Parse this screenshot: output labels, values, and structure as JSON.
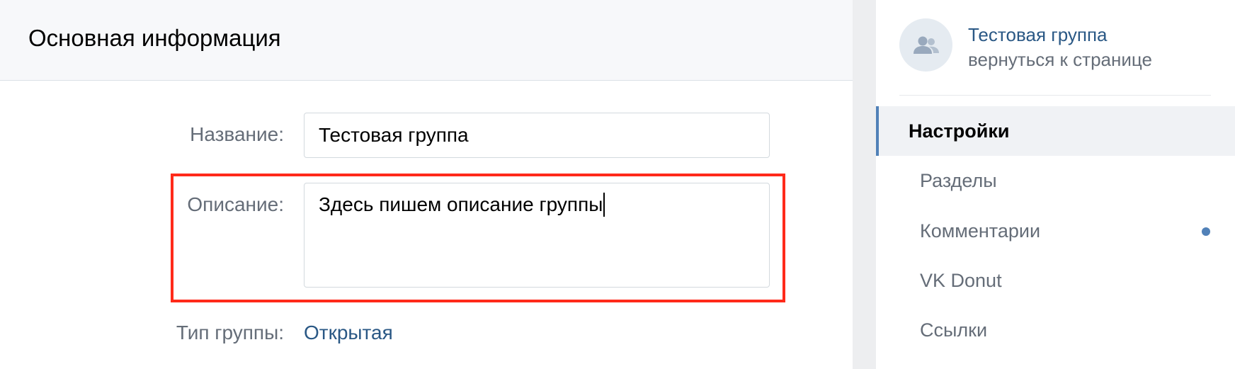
{
  "main": {
    "title": "Основная информация",
    "name_field": {
      "label": "Название:",
      "value": "Тестовая группа"
    },
    "description_field": {
      "label": "Описание:",
      "value": "Здесь пишем описание группы"
    },
    "group_type": {
      "label": "Тип группы:",
      "value": "Открытая"
    }
  },
  "sidebar": {
    "group_name": "Тестовая группа",
    "back_link": "вернуться к странице",
    "items": [
      {
        "label": "Настройки",
        "active": true
      },
      {
        "label": "Разделы"
      },
      {
        "label": "Комментарии",
        "has_dot": true
      },
      {
        "label": "VK Donut"
      },
      {
        "label": "Ссылки"
      }
    ]
  },
  "colors": {
    "link": "#2a5885",
    "accent": "#5181b8",
    "highlight": "#ff2a1a"
  },
  "icons": {
    "group_avatar": "group-icon"
  }
}
